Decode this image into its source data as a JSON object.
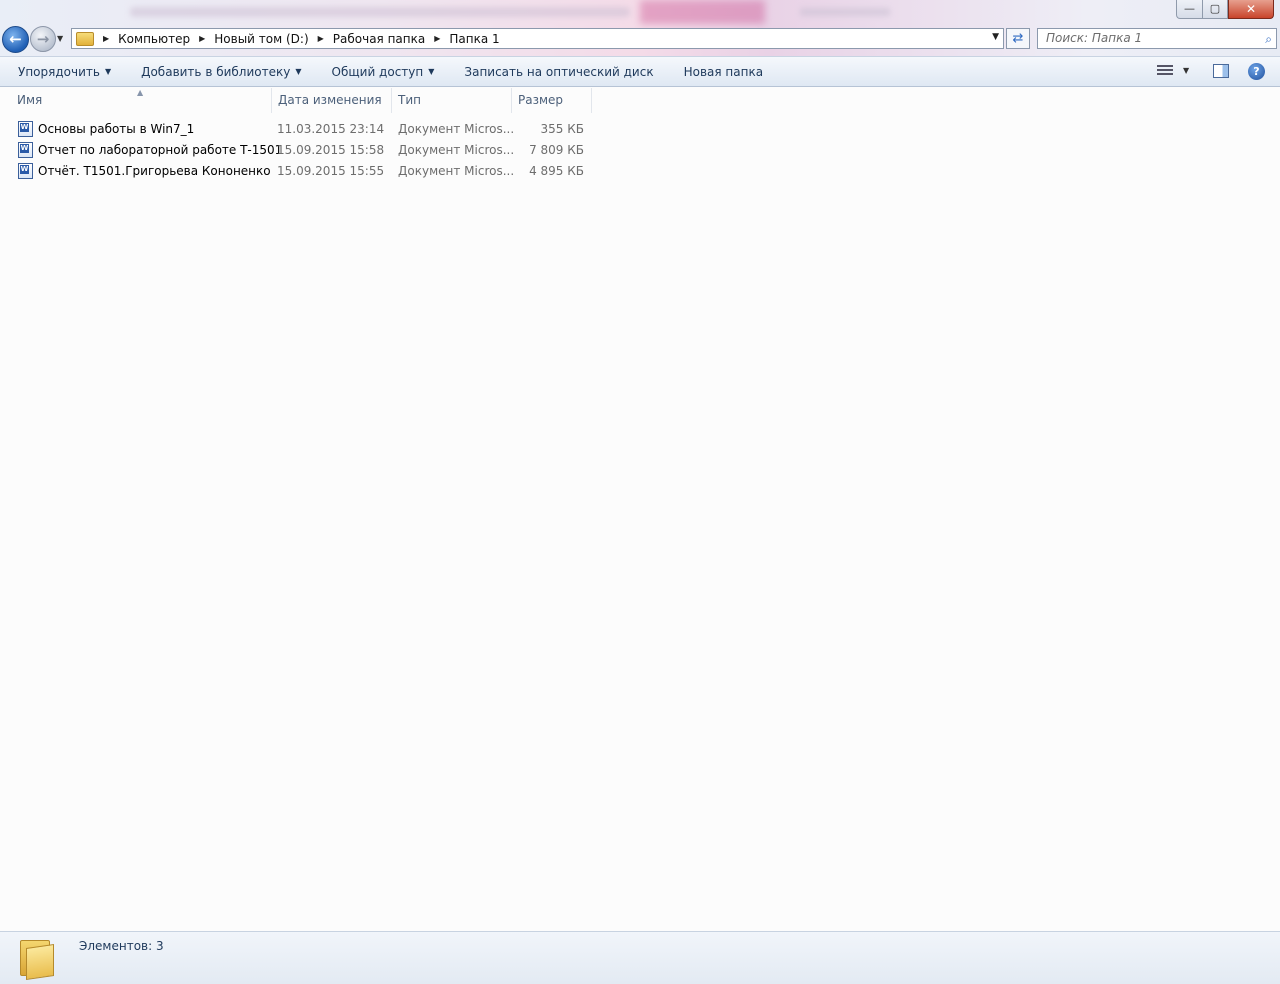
{
  "window": {
    "controls": {
      "minimize": "—",
      "maximize": "▢",
      "close": "✕"
    }
  },
  "nav": {
    "back_symbol": "←",
    "forward_symbol": "→"
  },
  "address": {
    "crumbs": [
      "Компьютер",
      "Новый том (D:)",
      "Рабочая папка",
      "Папка 1"
    ]
  },
  "search": {
    "placeholder": "Поиск: Папка 1"
  },
  "toolbar": {
    "organize": "Упорядочить",
    "add_to_library": "Добавить в библиотеку",
    "share": "Общий доступ",
    "burn": "Записать на оптический диск",
    "new_folder": "Новая папка",
    "help": "?"
  },
  "columns": {
    "name": "Имя",
    "date": "Дата изменения",
    "type": "Тип",
    "size": "Размер"
  },
  "files": [
    {
      "name": "Основы работы в  Win7_1",
      "date": "11.03.2015 23:14",
      "type": "Документ Micros...",
      "size": "355 КБ"
    },
    {
      "name": "Отчет по лабораторной работе Т-1501",
      "date": "15.09.2015 15:58",
      "type": "Документ Micros...",
      "size": "7 809 КБ"
    },
    {
      "name": "Отчёт. Т1501.Григорьева Кононенко",
      "date": "15.09.2015 15:55",
      "type": "Документ Micros...",
      "size": "4 895 КБ"
    }
  ],
  "status": {
    "items": "Элементов: 3"
  }
}
